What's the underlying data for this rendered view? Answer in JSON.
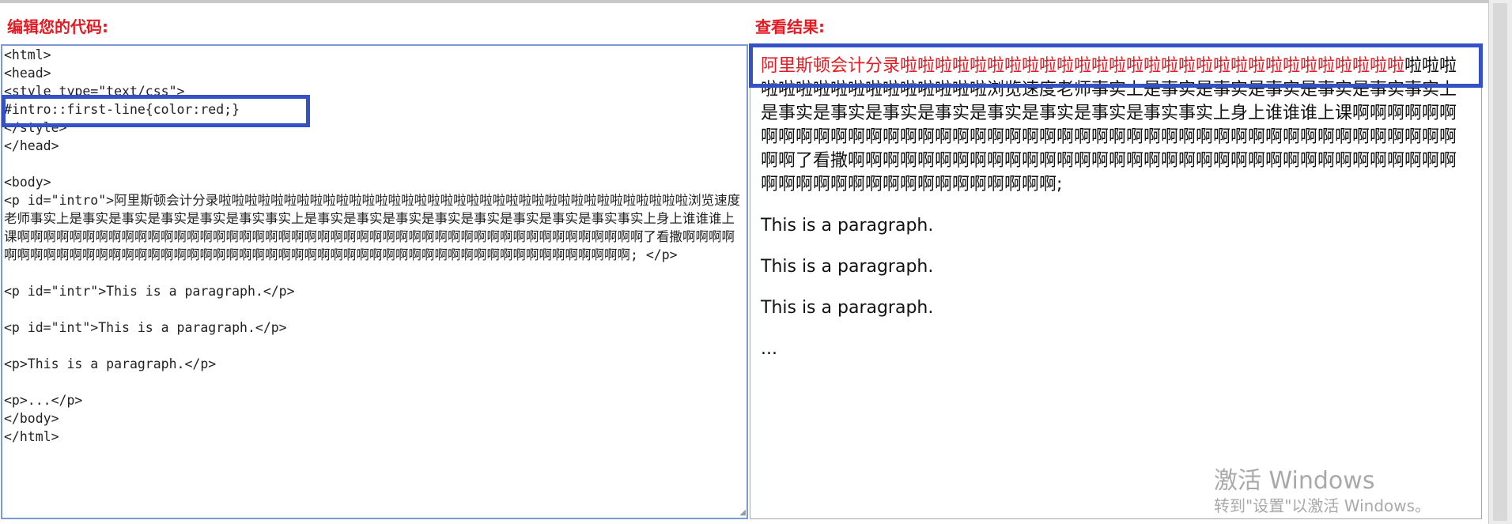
{
  "editor": {
    "label": "编辑您的代码:",
    "code": "<html>\n<head>\n<style type=\"text/css\">\n#intro::first-line{color:red;}\n</style>\n</head>\n\n<body>\n<p id=\"intro\">阿里斯顿会计分录啦啦啦啦啦啦啦啦啦啦啦啦啦啦啦啦啦啦啦啦啦啦啦啦啦啦啦啦啦啦啦啦啦啦啦啦浏览速度老师事实上是事实是事实是事实是事实是事实事实上是事实是事实是事实是事实是事实是事实是事实是事实事实上身上谁谁谁上课啊啊啊啊啊啊啊啊啊啊啊啊啊啊啊啊啊啊啊啊啊啊啊啊啊啊啊啊啊啊啊啊啊啊啊啊啊啊啊啊啊啊啊啊啊啊啊啊了看撒啊啊啊啊啊啊啊啊啊啊啊啊啊啊啊啊啊啊啊啊啊啊啊啊啊啊啊啊啊啊啊啊啊啊啊啊啊啊啊啊啊啊啊啊啊啊啊啊啊啊啊啊; </p>\n\n<p id=\"intr\">This is a paragraph.</p>\n\n<p id=\"int\">This is a paragraph.</p>\n\n<p>This is a paragraph.</p>\n\n<p>...</p>\n</body>\n</html>"
  },
  "result": {
    "label": "查看结果:",
    "intro_first_line": "阿里斯顿会计分录啦啦啦啦啦啦啦啦啦啦啦啦啦啦啦啦啦啦啦啦啦啦啦啦啦啦啦啦啦",
    "intro_rest": "啦啦啦啦啦啦啦啦啦啦啦啦啦啦啦啦浏览速度老师事实上是事实是事实是事实是事实是事实事实上是事实是事实是事实是事实是事实是事实是事实是事实事实上身上谁谁谁上课啊啊啊啊啊啊啊啊啊啊啊啊啊啊啊啊啊啊啊啊啊啊啊啊啊啊啊啊啊啊啊啊啊啊啊啊啊啊啊啊啊啊啊啊啊啊啊啊了看撒啊啊啊啊啊啊啊啊啊啊啊啊啊啊啊啊啊啊啊啊啊啊啊啊啊啊啊啊啊啊啊啊啊啊啊啊啊啊啊啊啊啊啊啊啊啊啊啊啊啊啊啊;",
    "paragraphs": [
      "This is a paragraph.",
      "This is a paragraph.",
      "This is a paragraph.",
      "..."
    ]
  },
  "watermark": {
    "title": "激活 Windows",
    "subtitle": "转到\"设置\"以激活 Windows。"
  },
  "colors": {
    "label_red": "#e31b23",
    "highlight_blue": "#3451c8",
    "editor_border": "#7a9cd3"
  }
}
